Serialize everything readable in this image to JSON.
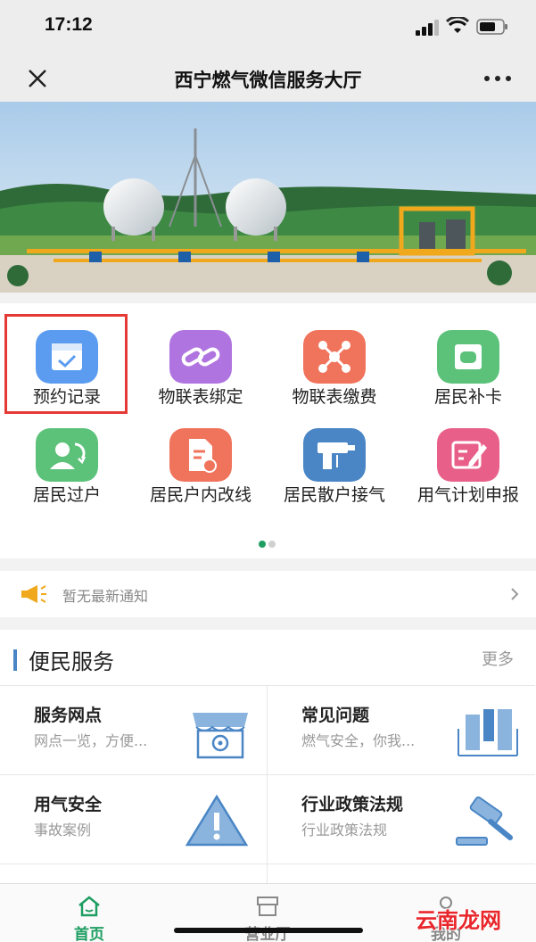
{
  "status_bar": {
    "time": "17:12"
  },
  "nav": {
    "title": "西宁燃气微信服务大厅"
  },
  "banner": {
    "alt": "gas-station-banner"
  },
  "grid": {
    "items": [
      {
        "label": "预约记录",
        "icon": "calendar-check-icon",
        "color": "#5b9cf0"
      },
      {
        "label": "物联表绑定",
        "icon": "link-icon",
        "color": "#b074e0"
      },
      {
        "label": "物联表缴费",
        "icon": "network-icon",
        "color": "#f0735b"
      },
      {
        "label": "居民补卡",
        "icon": "card-icon",
        "color": "#5cc27a"
      },
      {
        "label": "居民过户",
        "icon": "user-transfer-icon",
        "color": "#5cc27a"
      },
      {
        "label": "居民户内改线",
        "icon": "document-edit-icon",
        "color": "#f0735b"
      },
      {
        "label": "居民散户接气",
        "icon": "drill-icon",
        "color": "#4a86c5"
      },
      {
        "label": "用气计划申报",
        "icon": "pencil-form-icon",
        "color": "#e8608a"
      }
    ]
  },
  "notice": {
    "text": "暂无最新通知"
  },
  "services": {
    "title": "便民服务",
    "more": "更多",
    "items": [
      {
        "title": "服务网点",
        "subtitle": "网点一览，方便...",
        "icon": "storefront-icon"
      },
      {
        "title": "常见问题",
        "subtitle": "燃气安全，你我...",
        "icon": "faq-panels-icon"
      },
      {
        "title": "用气安全",
        "subtitle": "事故案例",
        "icon": "warning-icon"
      },
      {
        "title": "行业政策法规",
        "subtitle": "行业政策法规",
        "icon": "gavel-icon"
      }
    ]
  },
  "tabs": [
    {
      "label": "首页",
      "icon": "home-icon",
      "active": true
    },
    {
      "label": "营业厅",
      "icon": "hall-icon",
      "active": false
    },
    {
      "label": "我的",
      "icon": "user-icon",
      "active": false
    }
  ],
  "watermark": "云南龙网",
  "colors": {
    "accent": "#1e9e62",
    "highlight": "#e53935",
    "service_bar": "#4a86c5"
  }
}
